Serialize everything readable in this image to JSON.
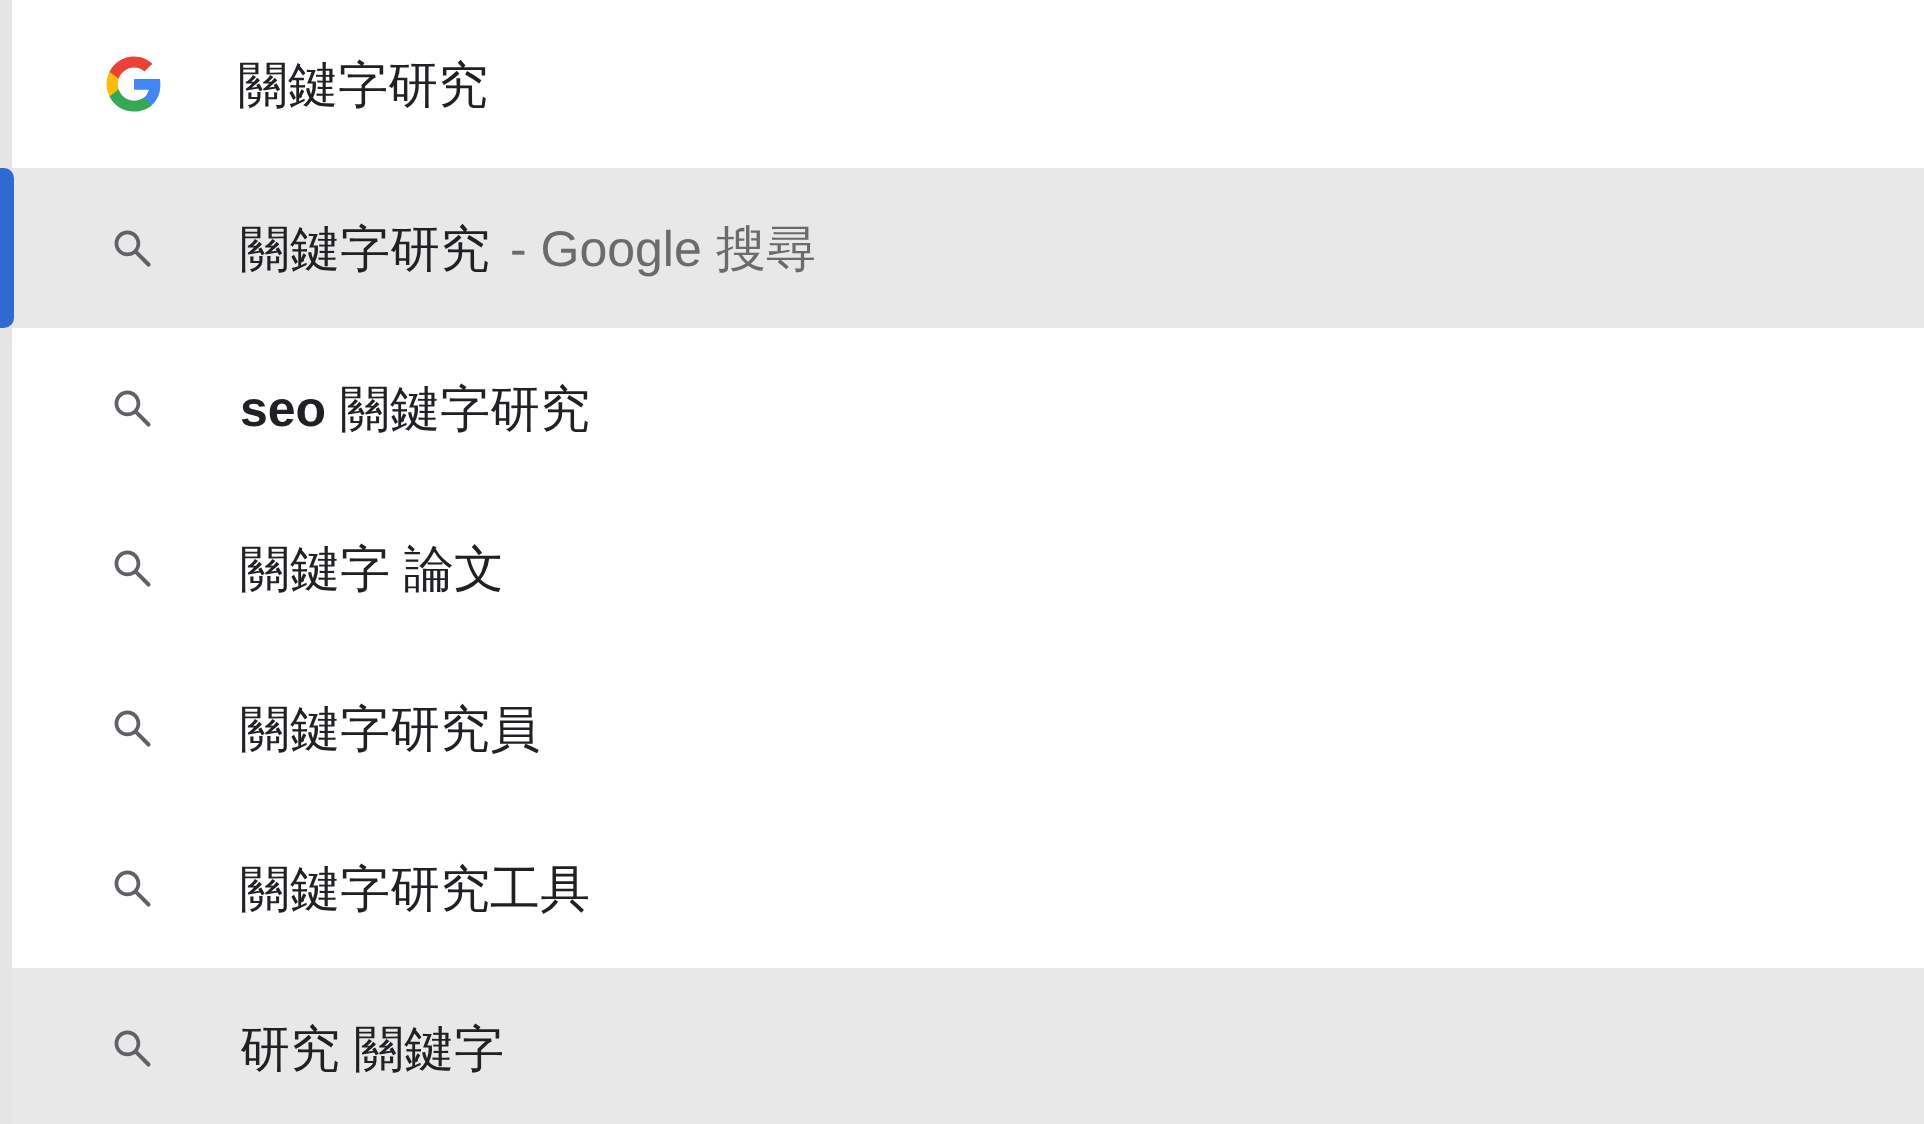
{
  "omnibox": {
    "value": "關鍵字研究"
  },
  "suggestions": [
    {
      "text": "關鍵字研究",
      "description": "- Google 搜尋",
      "selected": true,
      "hovered": false
    },
    {
      "text": "**seo** 關鍵字研究",
      "selected": false,
      "hovered": false
    },
    {
      "text": "關鍵字 論文",
      "selected": false,
      "hovered": false
    },
    {
      "text": "關鍵字研究員",
      "selected": false,
      "hovered": false
    },
    {
      "text": "關鍵字研究工具",
      "selected": false,
      "hovered": false
    },
    {
      "text": "研究 關鍵字",
      "selected": false,
      "hovered": true
    }
  ]
}
